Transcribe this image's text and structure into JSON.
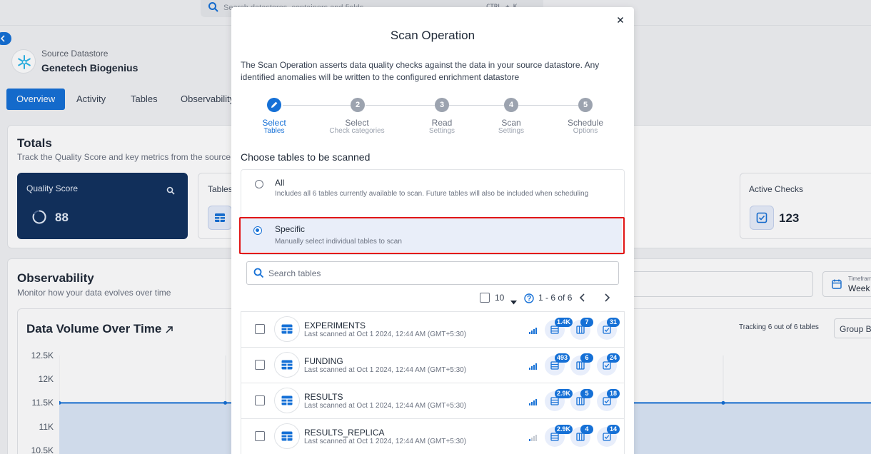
{
  "colors": {
    "primary": "#1570d6",
    "highlight": "#e11616",
    "quality_card": "#12315e"
  },
  "topbar": {
    "search_placeholder": "Search datastores, containers and fields",
    "shortcut": "CTRL + K"
  },
  "datastore": {
    "kicker": "Source Datastore",
    "name": "Genetech Biogenius",
    "icon": "snowflake-icon"
  },
  "tabs": [
    "Overview",
    "Activity",
    "Tables",
    "Observability"
  ],
  "totals": {
    "title": "Totals",
    "subtitle": "Track the Quality Score and key metrics from the source",
    "quality_score_label": "Quality Score",
    "quality_score_value": "88",
    "tables_label": "Tables",
    "active_checks_label": "Active Checks",
    "active_checks_value": "123"
  },
  "observability": {
    "title": "Observability",
    "subtitle": "Monitor how your data evolves over time",
    "timeframe_label": "Timeframe",
    "timeframe_value": "Week"
  },
  "data_volume": {
    "title": "Data Volume Over Time",
    "tracking": "Tracking 6 out of 6 tables",
    "group_by": "Group By"
  },
  "chart_data": {
    "type": "line",
    "title": "Data Volume Over Time",
    "y_ticks": [
      "12.5K",
      "12K",
      "11.5K",
      "11K",
      "10.5K"
    ],
    "ylim": [
      10500,
      12500
    ],
    "series": [
      {
        "values": [
          11500,
          11500,
          11500,
          11500,
          11500
        ]
      }
    ]
  },
  "modal": {
    "title": "Scan Operation",
    "description": "The Scan Operation asserts data quality checks against the data in your source datastore. Any identified anomalies will be written to the configured enrichment datastore",
    "steps": [
      {
        "number": "1",
        "title": "Select",
        "subtitle": "Tables",
        "active": true
      },
      {
        "number": "2",
        "title": "Select",
        "subtitle": "Check categories",
        "active": false
      },
      {
        "number": "3",
        "title": "Read",
        "subtitle": "Settings",
        "active": false
      },
      {
        "number": "4",
        "title": "Scan",
        "subtitle": "Settings",
        "active": false
      },
      {
        "number": "5",
        "title": "Schedule",
        "subtitle": "Options",
        "active": false
      }
    ],
    "choose_label": "Choose tables to be scanned",
    "options": {
      "all_title": "All",
      "all_desc": "Includes all 6 tables currently available to scan. Future tables will also be included when scheduling",
      "specific_title": "Specific",
      "specific_desc": "Manually select individual tables to scan",
      "selected": "Specific"
    },
    "search_placeholder": "Search tables",
    "pager": {
      "page_size": "10",
      "range": "1 - 6 of 6"
    },
    "rows": [
      {
        "name": "EXPERIMENTS",
        "meta": "Last scanned at Oct 1 2024, 12:44 AM (GMT+5:30)",
        "records": "1.4K",
        "fields": "7",
        "checks": "31",
        "signal": 4
      },
      {
        "name": "FUNDING",
        "meta": "Last scanned at Oct 1 2024, 12:44 AM (GMT+5:30)",
        "records": "493",
        "fields": "6",
        "checks": "24",
        "signal": 4
      },
      {
        "name": "RESULTS",
        "meta": "Last scanned at Oct 1 2024, 12:44 AM (GMT+5:30)",
        "records": "2.9K",
        "fields": "5",
        "checks": "18",
        "signal": 4
      },
      {
        "name": "RESULTS_REPLICA",
        "meta": "Last scanned at Oct 1 2024, 12:44 AM (GMT+5:30)",
        "records": "2.9K",
        "fields": "4",
        "checks": "14",
        "signal": 1
      }
    ]
  }
}
